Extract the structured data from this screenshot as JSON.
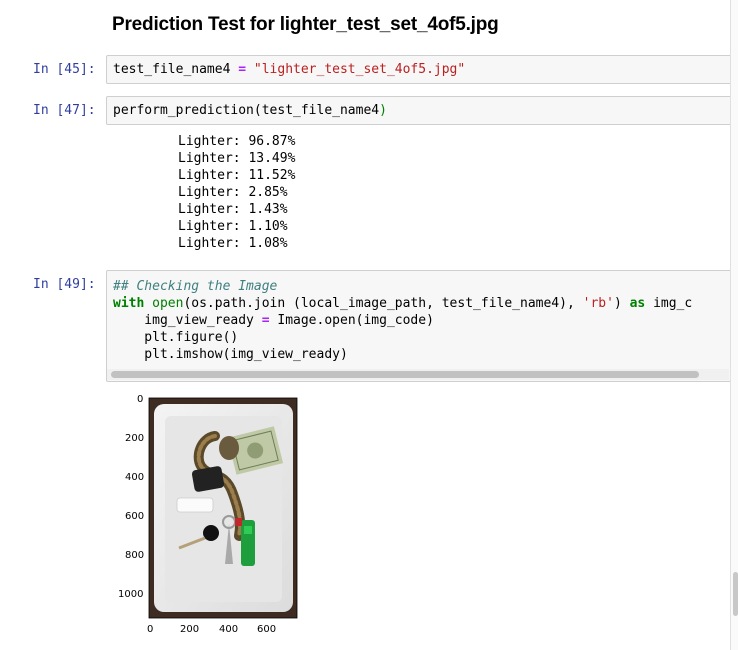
{
  "heading": "Prediction Test for lighter_test_set_4of5.jpg",
  "cells": {
    "c45": {
      "prompt": "In [45]:",
      "var": "test_file_name4",
      "eq": "=",
      "value": "\"lighter_test_set_4of5.jpg\""
    },
    "c47": {
      "prompt": "In [47]:",
      "func": "perform_prediction(",
      "arg": "test_file_name4",
      "close": ")",
      "outputs": [
        "Lighter: 96.87%",
        "Lighter: 13.49%",
        "Lighter: 11.52%",
        "Lighter: 2.85%",
        "Lighter: 1.43%",
        "Lighter: 1.10%",
        "Lighter: 1.08%"
      ]
    },
    "c49": {
      "prompt": "In [49]:",
      "comment": "## Checking the Image",
      "l2_with": "with",
      "l2_open": "open",
      "l2_a": "(os.path.join (local_image_path, test_file_name4), ",
      "l2_str": "'rb'",
      "l2_b": ") ",
      "l2_as": "as",
      "l2_c": " img_c",
      "l3_a": "    img_view_ready ",
      "l3_eq": "=",
      "l3_b": " Image.open(img_code)",
      "l4": "    plt.figure()",
      "l5": "    plt.imshow(img_view_ready)"
    }
  },
  "plot": {
    "y_ticks": [
      "0",
      "200",
      "400",
      "600",
      "800",
      "1000"
    ],
    "x_ticks": [
      "0",
      "200",
      "400",
      "600"
    ]
  }
}
